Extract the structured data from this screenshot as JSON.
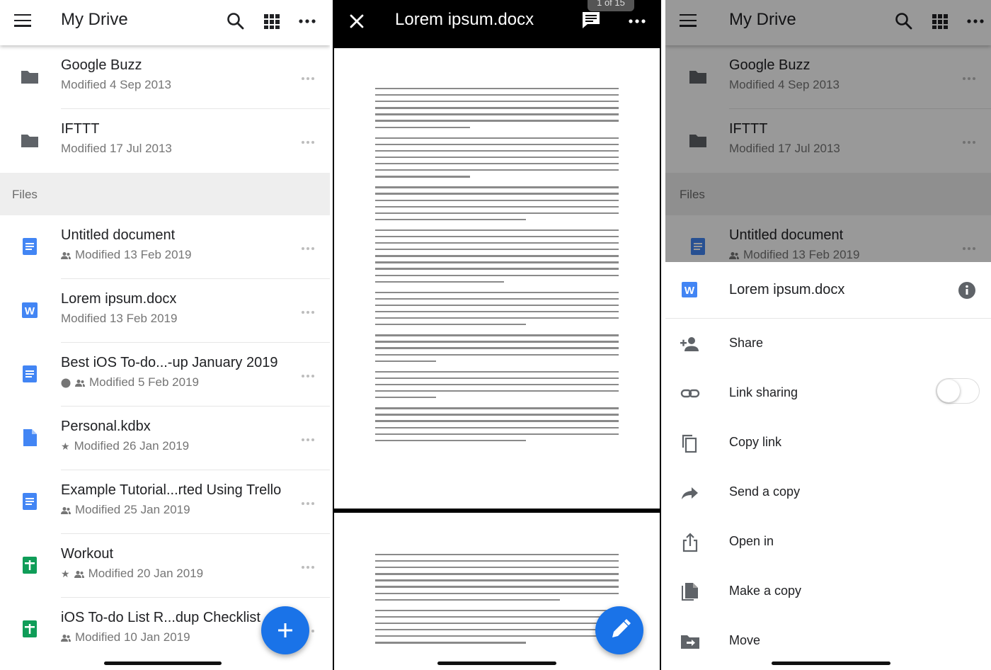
{
  "left": {
    "title": "My Drive",
    "folders": [
      {
        "title": "Google Buzz",
        "subtitle": "Modified 4 Sep 2013"
      },
      {
        "title": "IFTTT",
        "subtitle": "Modified 17 Jul 2013"
      }
    ],
    "section_label": "Files",
    "files": [
      {
        "title": "Untitled document",
        "subtitle": "Modified 13 Feb 2019",
        "icon": "docs-icon"
      },
      {
        "title": "Lorem ipsum.docx",
        "subtitle": "Modified 13 Feb 2019",
        "icon": "word-icon"
      },
      {
        "title": "Best iOS To-do...-up January 2019",
        "subtitle": "Modified 5 Feb 2019",
        "icon": "docs-icon"
      },
      {
        "title": "Personal.kdbx",
        "subtitle": "Modified 26 Jan 2019",
        "icon": "file-icon"
      },
      {
        "title": "Example Tutorial...rted Using Trello",
        "subtitle": "Modified 25 Jan 2019",
        "icon": "docs-icon"
      },
      {
        "title": "Workout",
        "subtitle": "Modified 20 Jan 2019",
        "icon": "sheets-icon"
      },
      {
        "title": "iOS To-do List R...dup Checklist",
        "subtitle": "Modified 10 Jan 2019",
        "icon": "sheets-icon"
      }
    ]
  },
  "viewer": {
    "title": "Lorem ipsum.docx",
    "page_indicator": "1 of 15"
  },
  "right": {
    "title": "My Drive",
    "folders": [
      {
        "title": "Google Buzz",
        "subtitle": "Modified 4 Sep 2013"
      },
      {
        "title": "IFTTT",
        "subtitle": "Modified 17 Jul 2013"
      }
    ],
    "section_label": "Files",
    "file": {
      "title": "Untitled document",
      "subtitle": "Modified 13 Feb 2019"
    },
    "sheet": {
      "title": "Lorem ipsum.docx",
      "actions": [
        "Share",
        "Link sharing",
        "Copy link",
        "Send a copy",
        "Open in",
        "Make a copy",
        "Move"
      ]
    }
  },
  "colors": {
    "accent": "#1a73e8",
    "docs": "#4285f4",
    "sheets": "#0f9d58",
    "folder": "#5f6368"
  }
}
